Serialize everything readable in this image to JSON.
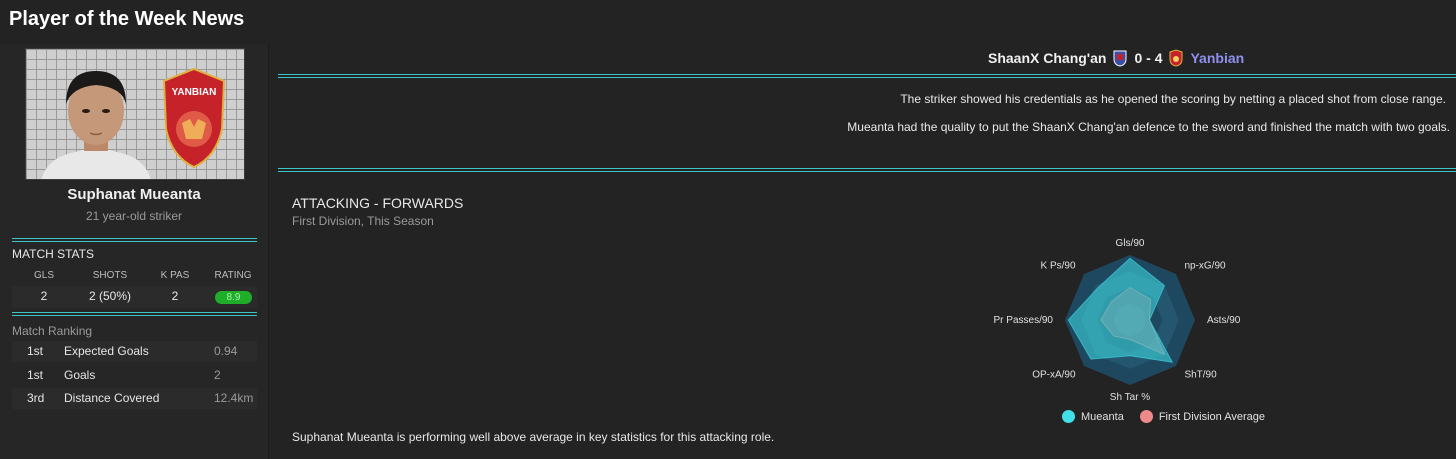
{
  "page": {
    "title": "Player of the Week News"
  },
  "player": {
    "name": "Suphanat Mueanta",
    "description": "21 year-old striker",
    "club_crest_text": "YANBIAN"
  },
  "match_stats": {
    "label": "MATCH STATS",
    "headers": [
      "GLS",
      "SHOTS",
      "K PAS",
      "RATING"
    ],
    "values": [
      "2",
      "2 (50%)",
      "2",
      "8.9"
    ]
  },
  "match_ranking": {
    "label": "Match Ranking",
    "rows": [
      {
        "pos": "1st",
        "name": "Expected Goals",
        "value": "0.94"
      },
      {
        "pos": "1st",
        "name": "Goals",
        "value": "2"
      },
      {
        "pos": "3rd",
        "name": "Distance Covered",
        "value": "12.4km"
      }
    ]
  },
  "match": {
    "home_team": "ShaanX Chang'an",
    "score": "0 - 4",
    "away_team": "Yanbian"
  },
  "news": {
    "line1": "The striker showed his credentials as he opened the scoring by netting a placed shot from close range.",
    "line2": "Mueanta had the quality to put the ShaanX Chang'an defence to the sword and finished the match with two goals."
  },
  "attacking": {
    "title": "ATTACKING - FORWARDS",
    "subtitle": "First Division, This Season",
    "summary": "Suphanat Mueanta is performing well above average in key statistics for this attacking role."
  },
  "chart_data": {
    "type": "radar",
    "axes": [
      "Gls/90",
      "np-xG/90",
      "Asts/90",
      "ShT/90",
      "Sh Tar %",
      "OP-xA/90",
      "Pr Passes/90",
      "K Ps/90"
    ],
    "series": [
      {
        "name": "Mueanta",
        "color": "#3fe0e8",
        "values": [
          0.95,
          0.75,
          0.3,
          0.92,
          0.55,
          0.85,
          0.95,
          0.7
        ]
      },
      {
        "name": "First Division Average",
        "color": "#f08a8a",
        "values": [
          0.5,
          0.45,
          0.3,
          0.75,
          0.3,
          0.35,
          0.45,
          0.4
        ]
      }
    ],
    "colors": {
      "radar_bg": "#1e4860",
      "ring": "#24576f"
    }
  },
  "colors": {
    "accent": "#3ec6c6",
    "rating": "#1fae2a",
    "away_team": "#8f8ff0"
  }
}
